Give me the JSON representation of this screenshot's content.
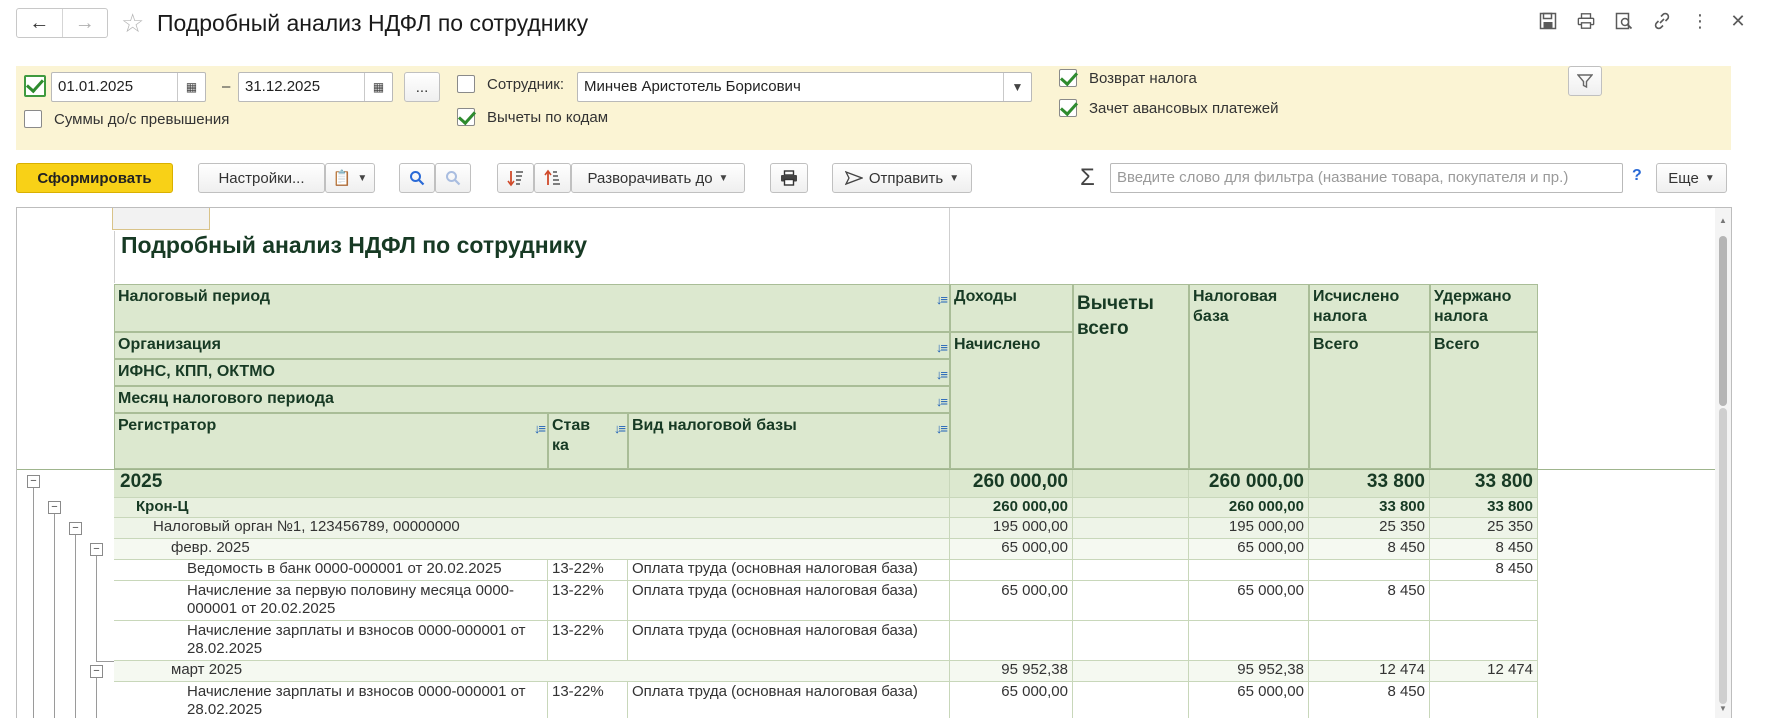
{
  "window": {
    "title": "Подробный анализ НДФЛ по сотруднику"
  },
  "filters": {
    "date_from": "01.01.2025",
    "date_dash": "–",
    "date_to": "31.12.2025",
    "ellipsis": "...",
    "over_threshold_label": "Суммы до/с превышения",
    "employee_label": "Сотрудник:",
    "employee_value": "Минчев Аристотель Борисович",
    "deductions_by_codes_label": "Вычеты по кодам",
    "tax_refund_label": "Возврат налога",
    "advance_offset_label": "Зачет авансовых платежей"
  },
  "toolbar": {
    "generate": "Сформировать",
    "settings": "Настройки...",
    "expand_to": "Разворачивать до",
    "send": "Отправить",
    "sigma": "Σ",
    "filter_placeholder": "Введите слово для фильтра (название товара, покупателя и пр.)",
    "help": "?",
    "more": "Еще"
  },
  "report": {
    "title": "Подробный анализ НДФЛ по сотруднику",
    "headers": {
      "tax_period": "Налоговый период",
      "organization": "Организация",
      "ifns": "ИФНС, КПП, ОКТМО",
      "month": "Месяц налогового периода",
      "registrar": "Регистратор",
      "rate": "Став ка",
      "base_type": "Вид налоговой базы",
      "income": "Доходы",
      "income_sub": "Начислено",
      "deductions": "Вычеты всего",
      "tax_base": "Налоговая база",
      "calculated": "Исчислено налога",
      "calculated_sub": "Всего",
      "withheld": "Удержано налога",
      "withheld_sub": "Всего"
    },
    "rows": [
      {
        "label": "2025",
        "rate": "",
        "base": "",
        "income": "260 000,00",
        "deduct": "",
        "taxbase": "260 000,00",
        "calc": "33 800",
        "withheld": "33 800"
      },
      {
        "label": "Крон-Ц",
        "rate": "",
        "base": "",
        "income": "260 000,00",
        "deduct": "",
        "taxbase": "260 000,00",
        "calc": "33 800",
        "withheld": "33 800"
      },
      {
        "label": "Налоговый орган №1, 123456789, 00000000",
        "rate": "",
        "base": "",
        "income": "195 000,00",
        "deduct": "",
        "taxbase": "195 000,00",
        "calc": "25 350",
        "withheld": "25 350"
      },
      {
        "label": "февр. 2025",
        "rate": "",
        "base": "",
        "income": "65 000,00",
        "deduct": "",
        "taxbase": "65 000,00",
        "calc": "8 450",
        "withheld": "8 450"
      },
      {
        "label": "Ведомость в банк 0000-000001 от 20.02.2025",
        "rate": "13-22%",
        "base": "Оплата труда (основная налоговая база)",
        "income": "",
        "deduct": "",
        "taxbase": "",
        "calc": "",
        "withheld": "8 450"
      },
      {
        "label": "Начисление за первую половину месяца 0000-000001 от 20.02.2025",
        "rate": "13-22%",
        "base": "Оплата труда (основная налоговая база)",
        "income": "65 000,00",
        "deduct": "",
        "taxbase": "65 000,00",
        "calc": "8 450",
        "withheld": ""
      },
      {
        "label": "Начисление зарплаты и взносов 0000-000001 от 28.02.2025",
        "rate": "13-22%",
        "base": "Оплата труда (основная налоговая база)",
        "income": "",
        "deduct": "",
        "taxbase": "",
        "calc": "",
        "withheld": ""
      },
      {
        "label": "март 2025",
        "rate": "",
        "base": "",
        "income": "95 952,38",
        "deduct": "",
        "taxbase": "95 952,38",
        "calc": "12 474",
        "withheld": "12 474"
      },
      {
        "label": "Начисление зарплаты и взносов 0000-000001 от 28.02.2025",
        "rate": "13-22%",
        "base": "Оплата труда (основная налоговая база)",
        "income": "65 000,00",
        "deduct": "",
        "taxbase": "65 000,00",
        "calc": "8 450",
        "withheld": ""
      }
    ]
  }
}
